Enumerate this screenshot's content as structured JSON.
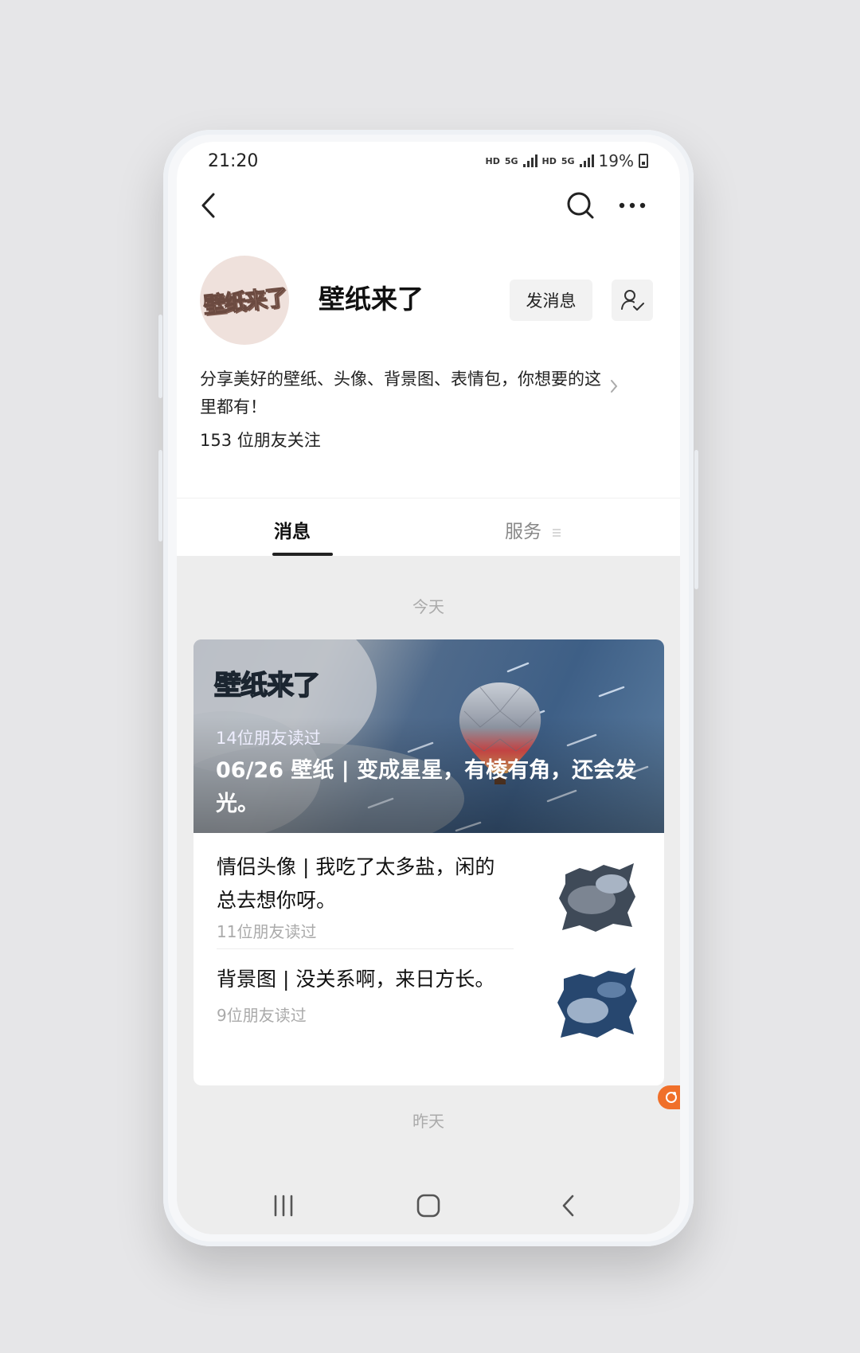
{
  "status": {
    "time": "21:20",
    "network_1": "HD",
    "net_type_1": "5G",
    "network_2": "HD",
    "net_type_2": "5G",
    "battery": "19%"
  },
  "nav": {
    "back_icon": "chevron-left-icon",
    "search_icon": "search-icon",
    "more_icon": "more-horizontal-icon"
  },
  "profile": {
    "avatar_text": "壁纸来了",
    "name": "壁纸来了",
    "message_button": "发消息",
    "description": "分享美好的壁纸、头像、背景图、表情包，你想要的这里都有！",
    "followers": "153 位朋友关注"
  },
  "tabs": {
    "messages": "消息",
    "services": "服务"
  },
  "feed": {
    "today_label": "今天",
    "featured": {
      "logo": "壁纸来了",
      "read_count": "14位朋友读过",
      "title": "06/26 壁纸 | 变成星星，有棱有角，还会发光。"
    },
    "items": [
      {
        "title": "情侣头像 | 我吃了太多盐，闲的总去想你呀。",
        "read_count": "11位朋友读过"
      },
      {
        "title": "背景图 | 没关系啊，来日方长。",
        "read_count": "9位朋友读过"
      }
    ],
    "yesterday_label": "昨天"
  },
  "colors": {
    "accent": "#f0702a",
    "background": "#ededed",
    "text": "#111111",
    "muted": "#aaaaaa"
  }
}
